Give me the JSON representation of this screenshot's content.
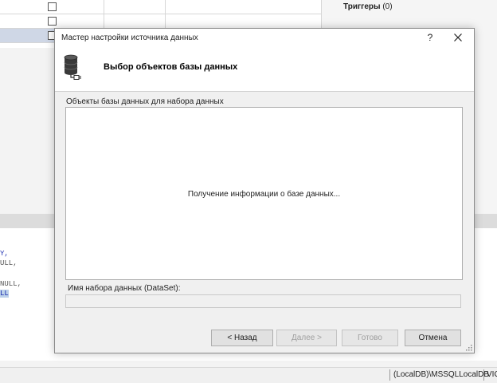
{
  "background": {
    "triggers": {
      "label": "Триггеры",
      "count": "(0)"
    },
    "script_fragments": [
      "Y,",
      "ULL,",
      "NULL,",
      "LL"
    ],
    "status_bar": {
      "server": "(LocalDB)\\MSSQLLocalDB",
      "extra": "VIG"
    }
  },
  "dialog": {
    "title": "Мастер настройки источника данных",
    "help_label": "?",
    "heading": "Выбор объектов базы данных",
    "objects_label": "Объекты базы данных для набора данных",
    "loading_text": "Получение информации о базе данных...",
    "dataset_label": "Имя набора данных (DataSet):",
    "dataset_value": "",
    "buttons": {
      "back": "< Назад",
      "next": "Далее >",
      "finish": "Готово",
      "cancel": "Отмена"
    }
  },
  "colors": {
    "dialog_bg": "#f0f0f0",
    "selection_row": "#cfd7e6",
    "keyword": "#1d2fb0"
  },
  "icons": {
    "header": "database-connector-icon",
    "close": "close-icon",
    "help": "help-icon",
    "grip": "resize-grip-icon"
  }
}
